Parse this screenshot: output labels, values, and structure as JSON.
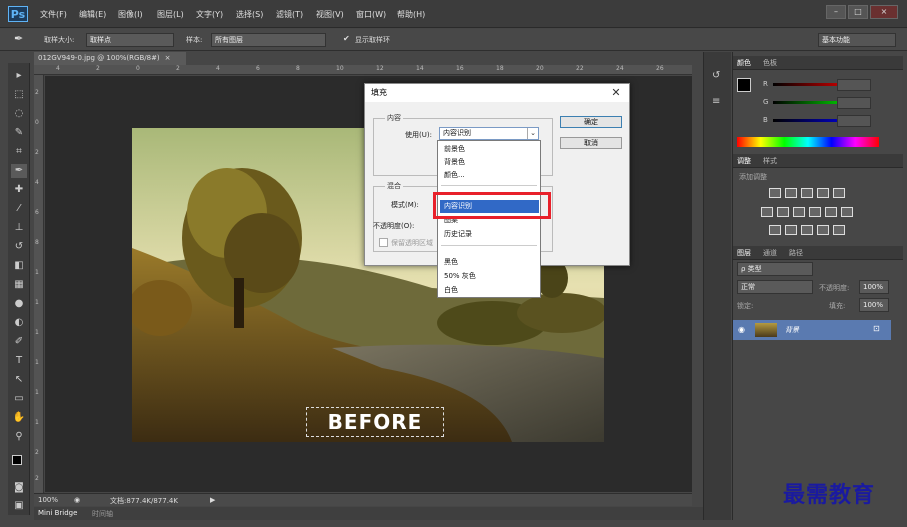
{
  "menubar": {
    "app_icon": "Ps",
    "menus": [
      "文件(F)",
      "编辑(E)",
      "图像(I)",
      "图层(L)",
      "文字(Y)",
      "选择(S)",
      "滤镜(T)",
      "视图(V)",
      "窗口(W)",
      "帮助(H)"
    ],
    "window_buttons": [
      "–",
      "□",
      "×"
    ]
  },
  "optbar": {
    "sample_size_label": "取样大小:",
    "sample_size_value": "取样点",
    "sample_label": "样本:",
    "sample_value": "所有图层",
    "show_ring_label": "显示取样环",
    "workspace": "基本功能"
  },
  "document": {
    "tab_title": "012GV949-0.jpg @ 100%(RGB/8#)",
    "ruler_h": [
      "4",
      "2",
      "0",
      "2",
      "4",
      "6",
      "8",
      "10",
      "12",
      "14",
      "16",
      "18",
      "20",
      "22",
      "24",
      "26"
    ],
    "ruler_v": [
      "2",
      "0",
      "2",
      "4",
      "6",
      "8",
      "1",
      "1",
      "1",
      "1",
      "1",
      "1",
      "2",
      "2"
    ],
    "before_text": "BEFORE"
  },
  "status": {
    "zoom": "100%",
    "doc_info": "文档:877.4K/877.4K",
    "tabs": [
      "Mini Bridge",
      "时间轴"
    ]
  },
  "panels": {
    "color_tabs": [
      "颜色",
      "色板"
    ],
    "channels": [
      "R",
      "G",
      "B"
    ],
    "adjust_tabs": [
      "调整",
      "样式"
    ],
    "adjust_title": "添加调整",
    "layers_tabs": [
      "图层",
      "通道",
      "路径"
    ],
    "filter_kind": "ρ 类型",
    "blend_mode": "正常",
    "opacity_label": "不透明度:",
    "lock_label": "锁定:",
    "fill_label": "填充:",
    "percent": "100%",
    "layer_name": "背景"
  },
  "dialog": {
    "title": "填充",
    "content_group": "内容",
    "use_label": "使用(U):",
    "use_value": "内容识别",
    "blend_group": "混合",
    "mode_label": "模式(M):",
    "opacity_label": "不透明度(O):",
    "preserve_label": "保留透明区域",
    "ok_button": "确定",
    "cancel_button": "取消"
  },
  "dropdown": {
    "items": [
      "前景色",
      "背景色",
      "颜色...",
      "内容识别",
      "图案",
      "历史记录",
      "黑色",
      "50% 灰色",
      "白色"
    ],
    "selected": "内容识别"
  },
  "watermark": "最需教育",
  "colors": {
    "accent": "#3169c6",
    "highlight": "#e8202a",
    "watermark": "#1a1aa0"
  }
}
